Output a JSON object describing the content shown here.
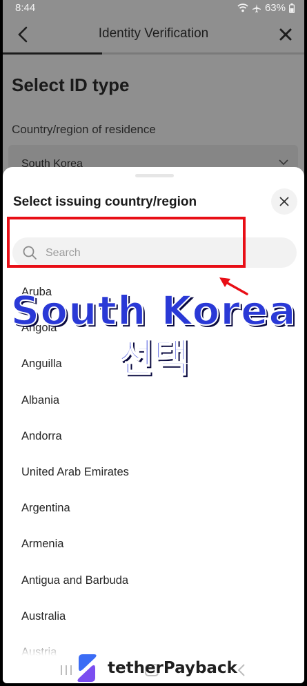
{
  "status_bar": {
    "time": "8:44",
    "battery": "63%"
  },
  "header": {
    "title": "Identity Verification",
    "progress": 0.33
  },
  "page": {
    "title": "Select ID type",
    "field_label": "Country/region of residence",
    "selected_country": "South Korea"
  },
  "sheet": {
    "title": "Select issuing country/region",
    "search_placeholder": "Search",
    "search_value": "",
    "countries": [
      "Aruba",
      "Angola",
      "Anguilla",
      "Albania",
      "Andorra",
      "United Arab Emirates",
      "Argentina",
      "Armenia",
      "Antigua and Barbuda",
      "Australia",
      "Austria"
    ]
  },
  "overlay": {
    "caption_line1": "South Korea",
    "caption_line2": "선택",
    "watermark": "tetherPayback",
    "highlight_color": "#e80e16",
    "caption_color": "#2a39d6"
  },
  "icons": {
    "back": "chevron-left-icon",
    "close": "close-icon",
    "search": "search-icon",
    "wifi": "wifi-icon",
    "airplane": "airplane-icon",
    "battery": "battery-icon"
  }
}
